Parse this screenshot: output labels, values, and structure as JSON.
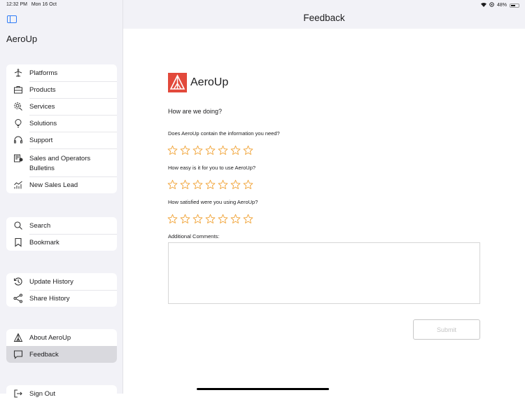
{
  "status_bar": {
    "time": "12:32 PM",
    "date": "Mon 16 Oct",
    "battery": "48%"
  },
  "sidebar": {
    "app_title": "AeroUp",
    "groups": [
      {
        "items": [
          {
            "label": "Platforms",
            "icon": "airplane-icon"
          },
          {
            "label": "Products",
            "icon": "briefcase-icon"
          },
          {
            "label": "Services",
            "icon": "gear-wrench-icon"
          },
          {
            "label": "Solutions",
            "icon": "lightbulb-icon"
          },
          {
            "label": "Support",
            "icon": "headset-icon"
          },
          {
            "label": "Sales and Operators Bulletins",
            "icon": "bulletin-icon"
          },
          {
            "label": "New Sales Lead",
            "icon": "chart-icon"
          }
        ]
      },
      {
        "items": [
          {
            "label": "Search",
            "icon": "search-icon"
          },
          {
            "label": "Bookmark",
            "icon": "bookmark-icon"
          }
        ]
      },
      {
        "items": [
          {
            "label": "Update History",
            "icon": "history-icon"
          },
          {
            "label": "Share History",
            "icon": "share-icon"
          }
        ]
      },
      {
        "items": [
          {
            "label": "About AeroUp",
            "icon": "aeroup-logo-icon"
          },
          {
            "label": "Feedback",
            "icon": "feedback-icon",
            "selected": true
          }
        ]
      },
      {
        "items": [
          {
            "label": "Sign Out",
            "icon": "sign-out-icon"
          }
        ]
      }
    ]
  },
  "header": {
    "title": "Feedback"
  },
  "form": {
    "logo_text": "AeroUp",
    "intro": "How are we doing?",
    "questions": [
      {
        "text": "Does AeroUp contain the information you need?",
        "rating": 0,
        "max": 7
      },
      {
        "text": "How easy is it for you to use AeroUp?",
        "rating": 0,
        "max": 7
      },
      {
        "text": "How satisfied were you using AeroUp?",
        "rating": 0,
        "max": 7
      }
    ],
    "comments_label": "Additional Comments:",
    "comments_value": "",
    "submit_label": "Submit",
    "star_color": "#f0a030",
    "logo_color": "#e2493b"
  }
}
